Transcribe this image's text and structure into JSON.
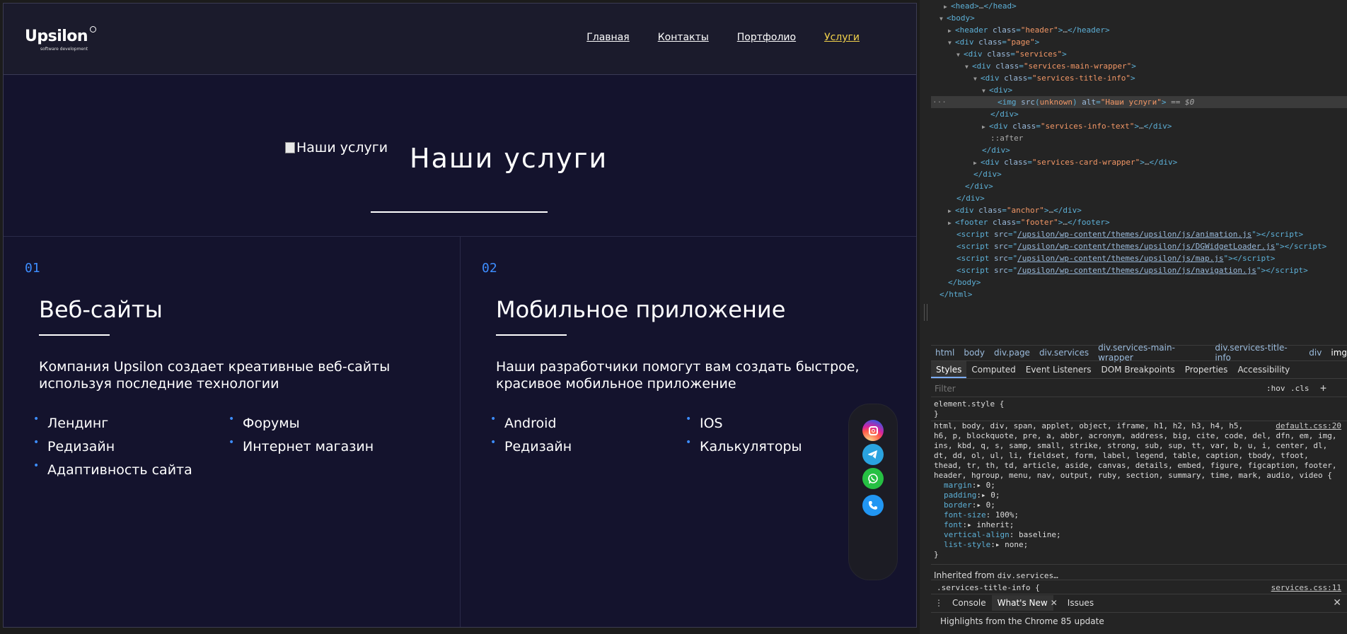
{
  "site": {
    "logo": {
      "brand": "Upsilon",
      "tagline": "software development"
    },
    "nav": [
      {
        "label": "Главная"
      },
      {
        "label": "Контакты"
      },
      {
        "label": "Портфолио"
      },
      {
        "label": "Услуги"
      }
    ],
    "hero": {
      "img_alt": "Наши услуги",
      "title": "Наши услуги"
    },
    "services": [
      {
        "num": "01",
        "title": "Веб-сайты",
        "desc": "Компания Upsilon создает креативные веб-сайты используя последние технологии",
        "items_a": [
          "Лендинг",
          "Редизайн",
          "Адаптивность сайта"
        ],
        "items_b": [
          "Форумы",
          "Интернет магазин"
        ]
      },
      {
        "num": "02",
        "title": "Мобильное приложение",
        "desc": "Наши разработчики помогут вам создать быстрое, красивое мобильное приложение",
        "items_a": [
          "Android",
          "Редизайн"
        ],
        "items_b": [
          "IOS",
          " Калькуляторы"
        ]
      }
    ],
    "social": [
      "instagram-icon",
      "telegram-icon",
      "whatsapp-icon",
      "phone-icon"
    ]
  },
  "devtools": {
    "breadcrumbs": [
      "html",
      "body",
      "div.page",
      "div.services",
      "div.services-main-wrapper",
      "div.services-title-info",
      "div",
      "img"
    ],
    "tabs": [
      "Styles",
      "Computed",
      "Event Listeners",
      "DOM Breakpoints",
      "Properties",
      "Accessibility"
    ],
    "filter_placeholder": "Filter",
    "hov": ":hov",
    "cls": ".cls",
    "element_style": "element.style {",
    "close_brace": "}",
    "reset_rule": {
      "selector_lines": [
        "html, body, div, span, applet, object, iframe, h1, h2, h3, h4, h5,",
        "h6, p, blockquote, pre, a, abbr, acronym, address, big, cite, code, del, dfn, em, img,",
        "ins, kbd, q, s, samp, small, strike, strong, sub, sup, tt, var, b, u, i, center, dl,",
        "dt, dd, ol, ul, li, fieldset, form, label, legend, table, caption, tbody, tfoot,",
        "thead, tr, th, td, article, aside, canvas, details, embed, figure, figcaption, footer,",
        "header, hgroup, menu, nav, output, ruby, section, summary, time, mark, audio, video {"
      ],
      "source": "default.css:20",
      "props": [
        {
          "name": "margin",
          "value": "▸ 0;"
        },
        {
          "name": "padding",
          "value": "▸ 0;"
        },
        {
          "name": "border",
          "value": "▸ 0;"
        },
        {
          "name": "font-size",
          "value": " 100%;"
        },
        {
          "name": "font",
          "value": "▸ inherit;"
        },
        {
          "name": "vertical-align",
          "value": " baseline;"
        },
        {
          "name": "list-style",
          "value": "▸ none;"
        }
      ]
    },
    "inherited_label": "Inherited from",
    "inherited_from": "div.services…",
    "partial_rule": ".services-title-info {",
    "partial_source": "services.css:11",
    "drawer_tabs": [
      "Console",
      "What's New",
      "Issues"
    ],
    "drawer_message": "Highlights from the Chrome 85 update"
  }
}
